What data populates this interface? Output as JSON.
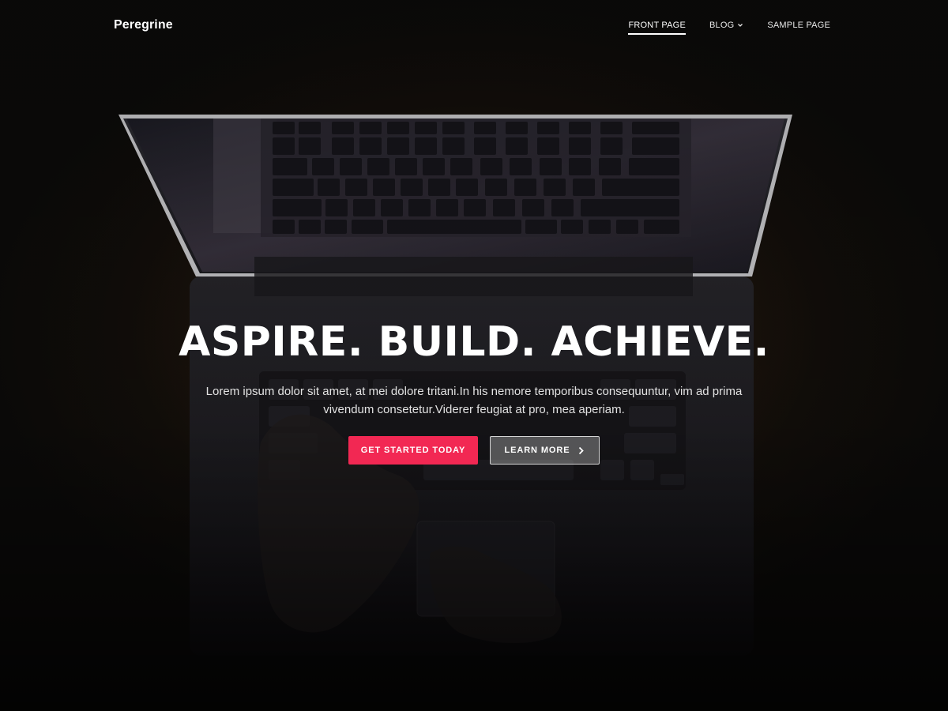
{
  "header": {
    "site_title": "Peregrine",
    "nav": [
      {
        "label": "Front Page",
        "active": true,
        "has_dropdown": false
      },
      {
        "label": "Blog",
        "active": false,
        "has_dropdown": true
      },
      {
        "label": "Sample Page",
        "active": false,
        "has_dropdown": false
      }
    ]
  },
  "hero": {
    "title": "ASPIRE. BUILD. ACHIEVE.",
    "text": "Lorem ipsum dolor sit amet, at mei dolore tritani.In his nemore temporibus consequuntur, vim ad prima vivendum consetetur.Viderer feugiat at pro, mea aperiam.",
    "primary_button": "Get Started Today",
    "secondary_button": "Learn More",
    "secondary_icon": "chevron-right-icon",
    "background_image": "laptop-keyboard-photo"
  },
  "colors": {
    "accent": "#f22853",
    "background": "#0b0a09",
    "text": "#ffffff"
  }
}
